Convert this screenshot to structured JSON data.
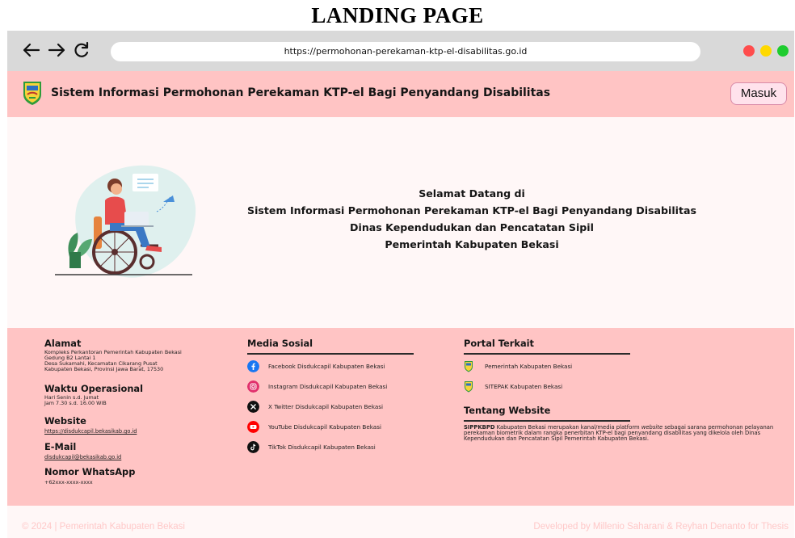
{
  "page_heading": "LANDING PAGE",
  "browser": {
    "url": "https://permohonan-perekaman-ktp-el-disabilitas.go.id",
    "icons": [
      "back-arrow-icon",
      "forward-arrow-icon",
      "reload-icon"
    ],
    "window_dot_colors": [
      "#ff4d4d",
      "#ffd900",
      "#1ecc2f"
    ]
  },
  "header": {
    "title": "Sistem Informasi Permohonan Perekaman KTP-el Bagi Penyandang Disabilitas",
    "login_label": "Masuk",
    "background_color": "#ffc4c4"
  },
  "hero": {
    "lines": [
      "Selamat Datang  di",
      "Sistem Informasi Permohonan Perekaman KTP-el Bagi Penyandang Disabilitas",
      "Dinas Kependudukan dan Pencatatan Sipil",
      "Pemerintah Kabupaten Bekasi"
    ],
    "illustration": "wheelchair-user-laptop-illustration"
  },
  "footer": {
    "address": {
      "heading": "Alamat",
      "lines": [
        "Kompleks Perkantoran Pemerintah Kabupaten Bekasi",
        "Gedung B2 Lantai 1",
        "Desa Sukamahi, Kecamatan Cikarang Pusat",
        "Kabupaten Bekasi, Provinsi Jawa Barat, 17530"
      ]
    },
    "hours": {
      "heading": "Waktu Operasional",
      "lines": [
        "Hari Senin s.d. Jumat",
        "Jam 7.30 s.d. 16.00 WIB"
      ]
    },
    "website": {
      "heading": "Website",
      "link": "https://disdukcapil.bekasikab.go.id"
    },
    "email": {
      "heading": "E-Mail",
      "link": "disdukcapil@bekasikab.go.id"
    },
    "whatsapp": {
      "heading": "Nomor WhatsApp",
      "value": "+62xxx-xxxx-xxxx"
    },
    "social": {
      "heading": "Media Sosial",
      "items": [
        {
          "label": "Facebook Disdukcapil Kabupaten Bekasi",
          "icon": "facebook-icon",
          "color": "#1877f2"
        },
        {
          "label": "Instagram Disdukcapil Kabupaten Bekasi",
          "icon": "instagram-icon",
          "color": "#e1306c"
        },
        {
          "label": "X Twitter Disdukcapil Kabupaten Bekasi",
          "icon": "x-twitter-icon",
          "color": "#111111"
        },
        {
          "label": "YouTube Disdukcapil Kabupaten Bekasi",
          "icon": "youtube-icon",
          "color": "#ff0000"
        },
        {
          "label": "TikTok Disdukcapil Kabupaten Bekasi",
          "icon": "tiktok-icon",
          "color": "#111111"
        }
      ]
    },
    "portal": {
      "heading": "Portal Terkait",
      "items": [
        {
          "label": "Pemerintah Kabupaten Bekasi",
          "icon": "bekasi-emblem-icon"
        },
        {
          "label": "SITEPAK Kabupaten Bekasi",
          "icon": "bekasi-emblem-icon"
        }
      ]
    },
    "about": {
      "heading": "Tentang Website",
      "brand": "SIPPKBPD",
      "text_before": " Kabupaten Bekasi merupakan kanal/media platform ",
      "italic": "website",
      "text_after": " sebagai sarana permohonan pelayanan perekaman biometrik dalam rangka penerbitan KTP-el bagi penyandang disabilitas yang dikelola oleh Dinas Kependudukan dan Pencatatan Sipil Pemerintah Kabupaten Bekasi."
    }
  },
  "bottom_bar": {
    "copyright": "© 2024 | Pemerintah Kabupaten Bekasi",
    "credit": "Developed by Millenio Saharani & Reyhan Denanto for Thesis"
  }
}
